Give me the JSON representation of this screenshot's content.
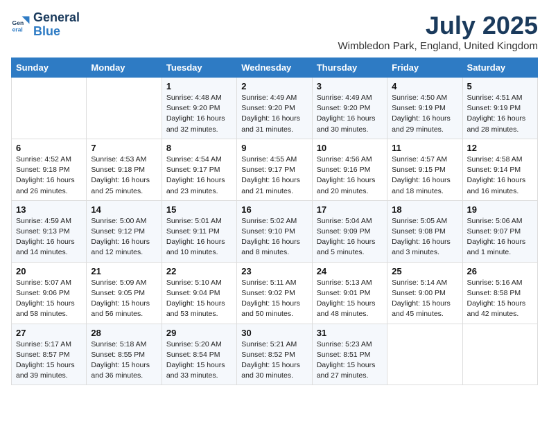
{
  "logo": {
    "line1": "General",
    "line2": "Blue"
  },
  "title": "July 2025",
  "location": "Wimbledon Park, England, United Kingdom",
  "weekdays": [
    "Sunday",
    "Monday",
    "Tuesday",
    "Wednesday",
    "Thursday",
    "Friday",
    "Saturday"
  ],
  "weeks": [
    [
      null,
      null,
      {
        "day": "1",
        "sunrise": "4:48 AM",
        "sunset": "9:20 PM",
        "daylight": "16 hours and 32 minutes."
      },
      {
        "day": "2",
        "sunrise": "4:49 AM",
        "sunset": "9:20 PM",
        "daylight": "16 hours and 31 minutes."
      },
      {
        "day": "3",
        "sunrise": "4:49 AM",
        "sunset": "9:20 PM",
        "daylight": "16 hours and 30 minutes."
      },
      {
        "day": "4",
        "sunrise": "4:50 AM",
        "sunset": "9:19 PM",
        "daylight": "16 hours and 29 minutes."
      },
      {
        "day": "5",
        "sunrise": "4:51 AM",
        "sunset": "9:19 PM",
        "daylight": "16 hours and 28 minutes."
      }
    ],
    [
      {
        "day": "6",
        "sunrise": "4:52 AM",
        "sunset": "9:18 PM",
        "daylight": "16 hours and 26 minutes."
      },
      {
        "day": "7",
        "sunrise": "4:53 AM",
        "sunset": "9:18 PM",
        "daylight": "16 hours and 25 minutes."
      },
      {
        "day": "8",
        "sunrise": "4:54 AM",
        "sunset": "9:17 PM",
        "daylight": "16 hours and 23 minutes."
      },
      {
        "day": "9",
        "sunrise": "4:55 AM",
        "sunset": "9:17 PM",
        "daylight": "16 hours and 21 minutes."
      },
      {
        "day": "10",
        "sunrise": "4:56 AM",
        "sunset": "9:16 PM",
        "daylight": "16 hours and 20 minutes."
      },
      {
        "day": "11",
        "sunrise": "4:57 AM",
        "sunset": "9:15 PM",
        "daylight": "16 hours and 18 minutes."
      },
      {
        "day": "12",
        "sunrise": "4:58 AM",
        "sunset": "9:14 PM",
        "daylight": "16 hours and 16 minutes."
      }
    ],
    [
      {
        "day": "13",
        "sunrise": "4:59 AM",
        "sunset": "9:13 PM",
        "daylight": "16 hours and 14 minutes."
      },
      {
        "day": "14",
        "sunrise": "5:00 AM",
        "sunset": "9:12 PM",
        "daylight": "16 hours and 12 minutes."
      },
      {
        "day": "15",
        "sunrise": "5:01 AM",
        "sunset": "9:11 PM",
        "daylight": "16 hours and 10 minutes."
      },
      {
        "day": "16",
        "sunrise": "5:02 AM",
        "sunset": "9:10 PM",
        "daylight": "16 hours and 8 minutes."
      },
      {
        "day": "17",
        "sunrise": "5:04 AM",
        "sunset": "9:09 PM",
        "daylight": "16 hours and 5 minutes."
      },
      {
        "day": "18",
        "sunrise": "5:05 AM",
        "sunset": "9:08 PM",
        "daylight": "16 hours and 3 minutes."
      },
      {
        "day": "19",
        "sunrise": "5:06 AM",
        "sunset": "9:07 PM",
        "daylight": "16 hours and 1 minute."
      }
    ],
    [
      {
        "day": "20",
        "sunrise": "5:07 AM",
        "sunset": "9:06 PM",
        "daylight": "15 hours and 58 minutes."
      },
      {
        "day": "21",
        "sunrise": "5:09 AM",
        "sunset": "9:05 PM",
        "daylight": "15 hours and 56 minutes."
      },
      {
        "day": "22",
        "sunrise": "5:10 AM",
        "sunset": "9:04 PM",
        "daylight": "15 hours and 53 minutes."
      },
      {
        "day": "23",
        "sunrise": "5:11 AM",
        "sunset": "9:02 PM",
        "daylight": "15 hours and 50 minutes."
      },
      {
        "day": "24",
        "sunrise": "5:13 AM",
        "sunset": "9:01 PM",
        "daylight": "15 hours and 48 minutes."
      },
      {
        "day": "25",
        "sunrise": "5:14 AM",
        "sunset": "9:00 PM",
        "daylight": "15 hours and 45 minutes."
      },
      {
        "day": "26",
        "sunrise": "5:16 AM",
        "sunset": "8:58 PM",
        "daylight": "15 hours and 42 minutes."
      }
    ],
    [
      {
        "day": "27",
        "sunrise": "5:17 AM",
        "sunset": "8:57 PM",
        "daylight": "15 hours and 39 minutes."
      },
      {
        "day": "28",
        "sunrise": "5:18 AM",
        "sunset": "8:55 PM",
        "daylight": "15 hours and 36 minutes."
      },
      {
        "day": "29",
        "sunrise": "5:20 AM",
        "sunset": "8:54 PM",
        "daylight": "15 hours and 33 minutes."
      },
      {
        "day": "30",
        "sunrise": "5:21 AM",
        "sunset": "8:52 PM",
        "daylight": "15 hours and 30 minutes."
      },
      {
        "day": "31",
        "sunrise": "5:23 AM",
        "sunset": "8:51 PM",
        "daylight": "15 hours and 27 minutes."
      },
      null,
      null
    ]
  ],
  "labels": {
    "sunrise_prefix": "Sunrise: ",
    "sunset_prefix": "Sunset: ",
    "daylight_prefix": "Daylight: "
  }
}
